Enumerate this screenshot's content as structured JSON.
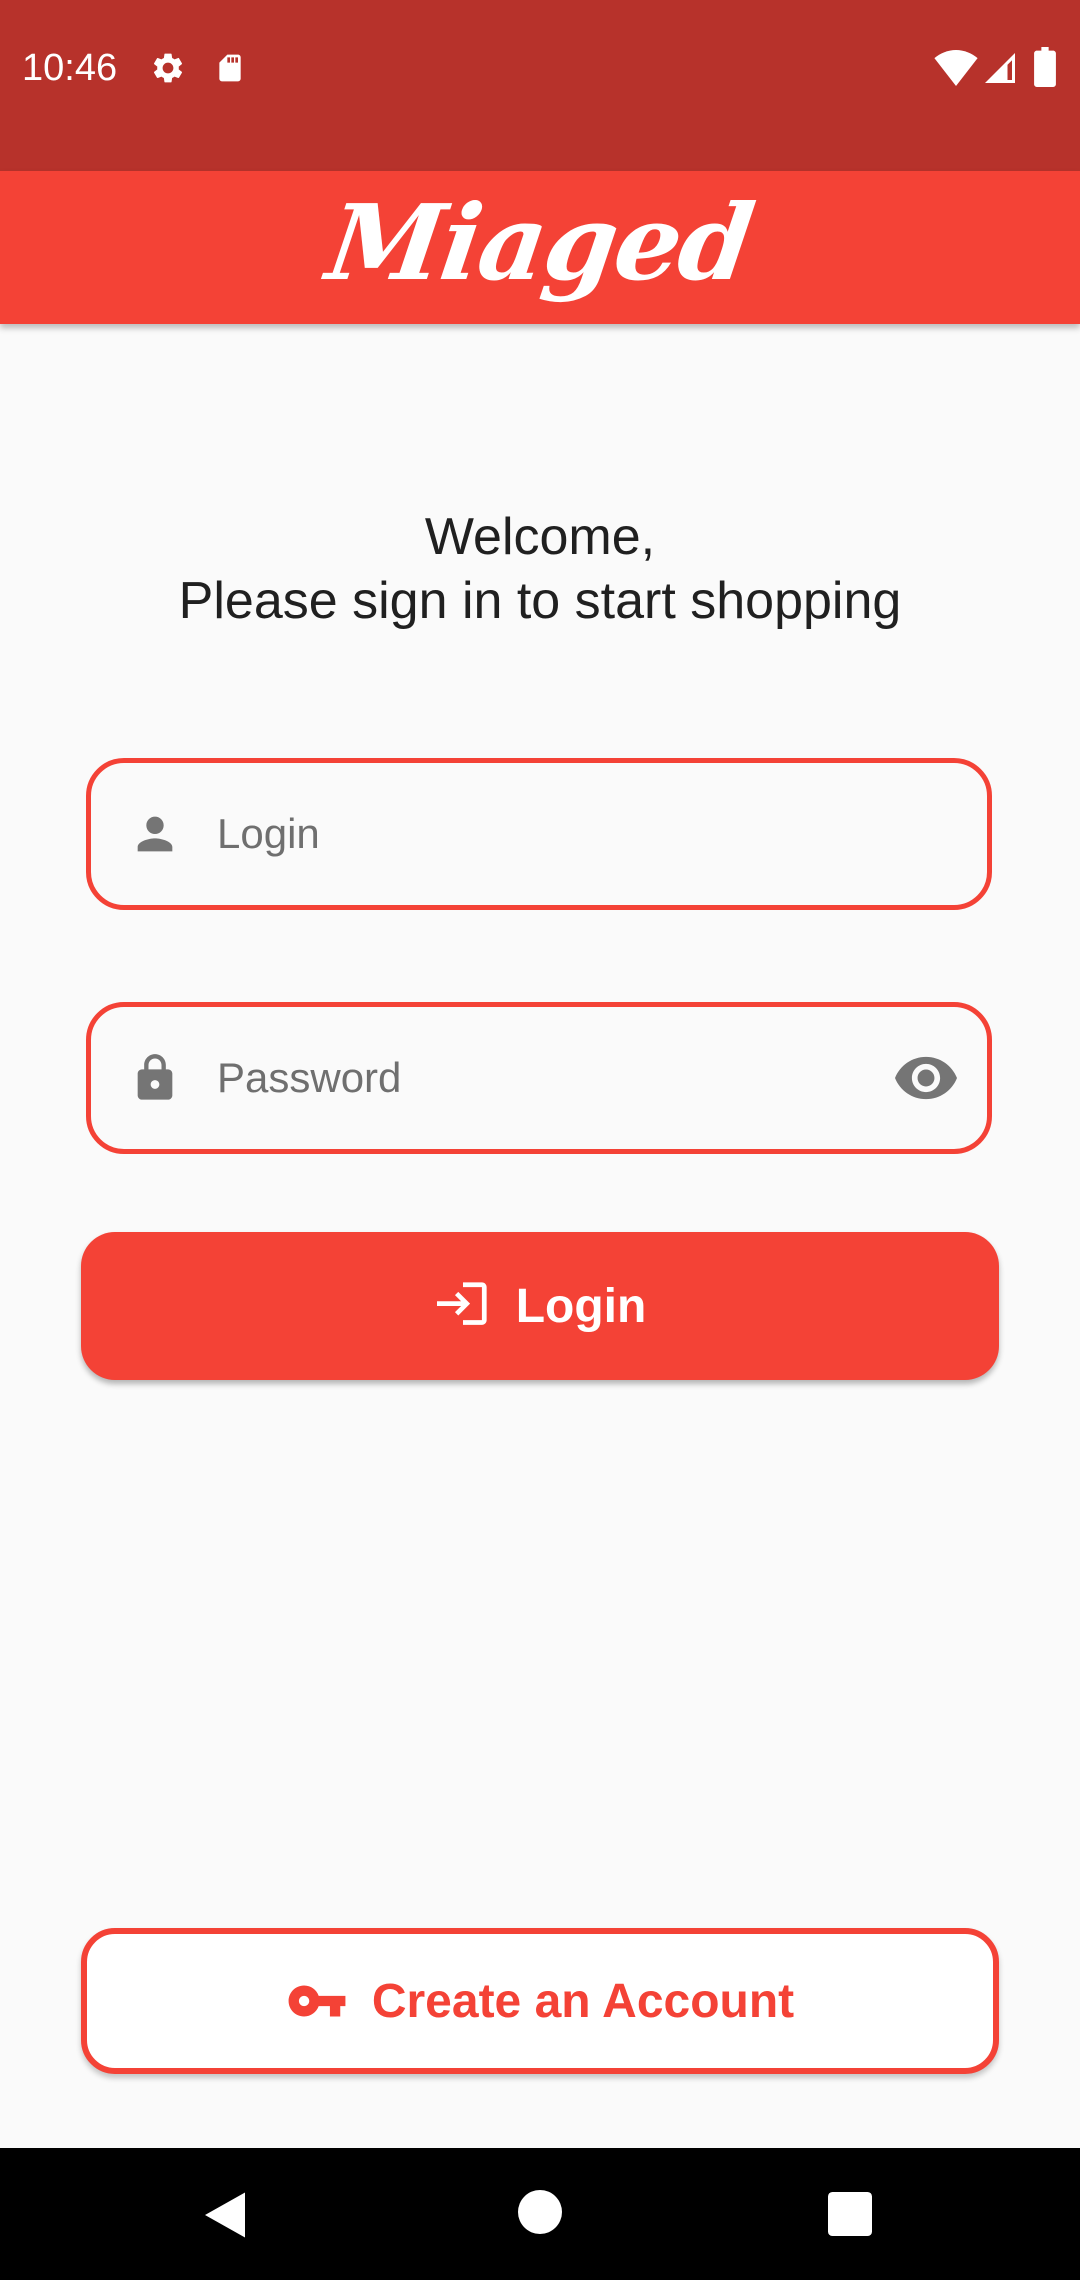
{
  "status_bar": {
    "time": "10:46",
    "icons": [
      "settings-gear-icon",
      "sd-card-icon",
      "wifi-icon",
      "cell-signal-icon",
      "battery-icon"
    ]
  },
  "app_bar": {
    "title": "Miaged"
  },
  "welcome": {
    "line1": "Welcome,",
    "line2": "Please sign in to start shopping"
  },
  "login_field": {
    "placeholder": "Login",
    "value": "",
    "icon": "person-icon"
  },
  "password_field": {
    "placeholder": "Password",
    "value": "",
    "icon": "lock-icon",
    "toggle_icon": "eye-icon"
  },
  "login_button": {
    "label": "Login",
    "icon": "login-arrow-icon"
  },
  "create_account_button": {
    "label": "Create an Account",
    "icon": "key-icon"
  },
  "nav_bar": {
    "icons": [
      "back-icon",
      "home-icon",
      "recents-icon"
    ]
  },
  "colors": {
    "primary": "#f44236",
    "status_bar": "#b7322b",
    "background": "#fafafa",
    "icon_gray": "#757575"
  }
}
